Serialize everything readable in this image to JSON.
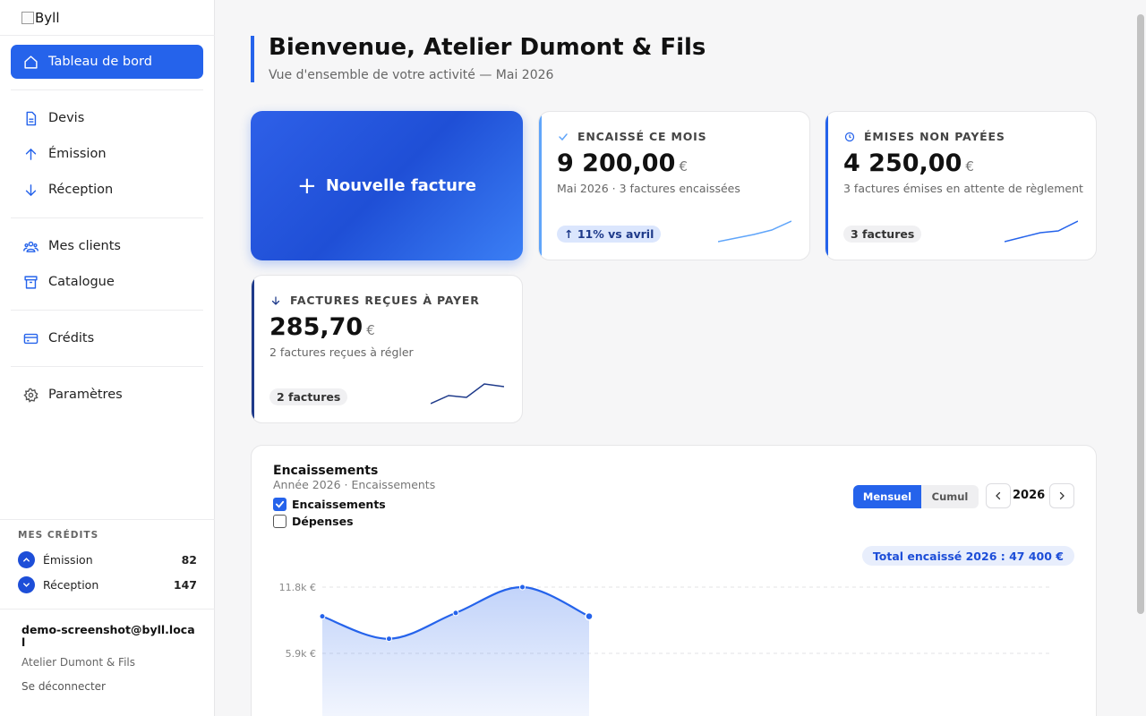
{
  "app": {
    "logo_alt": "Byll"
  },
  "sidebar": {
    "nav": [
      {
        "label": "Tableau de bord",
        "icon": "home-icon",
        "active": true
      },
      {
        "label": "Devis",
        "icon": "document-icon"
      },
      {
        "label": "Émission",
        "icon": "arrow-up-icon"
      },
      {
        "label": "Réception",
        "icon": "arrow-down-icon"
      },
      {
        "label": "Mes clients",
        "icon": "users-icon"
      },
      {
        "label": "Catalogue",
        "icon": "archive-icon"
      },
      {
        "label": "Crédits",
        "icon": "credit-card-icon"
      },
      {
        "label": "Paramètres",
        "icon": "gear-icon"
      }
    ],
    "credits": {
      "title": "MES CRÉDITS",
      "rows": [
        {
          "label": "Émission",
          "value": "82"
        },
        {
          "label": "Réception",
          "value": "147"
        }
      ]
    },
    "user": {
      "email": "demo-screenshot@byll.local",
      "company": "Atelier Dumont & Fils",
      "logout": "Se déconnecter"
    }
  },
  "header": {
    "title": "Bienvenue, Atelier Dumont & Fils",
    "subtitle": "Vue d'ensemble de votre activité — Mai 2026"
  },
  "new_invoice": {
    "label": "Nouvelle facture"
  },
  "kpis": [
    {
      "label": "ENCAISSÉ CE MOIS",
      "icon": "check-icon",
      "value": "9 200,00",
      "currency": "€",
      "desc": "Mai 2026 · 3 factures encaissées",
      "pill": "↑ 11% vs avril",
      "color": "#60a5fa"
    },
    {
      "label": "ÉMISES NON PAYÉES",
      "icon": "clock-icon",
      "value": "4 250,00",
      "currency": "€",
      "desc": "3 factures émises en attente de règlement",
      "pill": "3 factures",
      "color": "#2563eb"
    },
    {
      "label": "FACTURES REÇUES À PAYER",
      "icon": "arrow-down-icon",
      "value": "285,70",
      "currency": "€",
      "desc": "2 factures reçues à régler",
      "pill": "2 factures",
      "color": "#1e3a8a"
    }
  ],
  "chart_section": {
    "title": "Encaissements",
    "subtitle": "Année 2026 · Encaissements",
    "legend": [
      {
        "label": "Encaissements",
        "checked": true
      },
      {
        "label": "Dépenses",
        "checked": false
      }
    ],
    "toggle": {
      "monthly": "Mensuel",
      "cumulative": "Cumul",
      "selected": "Mensuel"
    },
    "year": "2026",
    "total": "Total encaissé 2026 : 47 400 €"
  },
  "chart_data": {
    "type": "area",
    "title": "Encaissements",
    "y_ticks": [
      "11.8k €",
      "5.9k €"
    ],
    "y_tick_values": [
      11800,
      5900
    ],
    "x_count": 12,
    "values": [
      9200,
      7200,
      9500,
      11800,
      9200
    ],
    "color": "#2563eb"
  }
}
